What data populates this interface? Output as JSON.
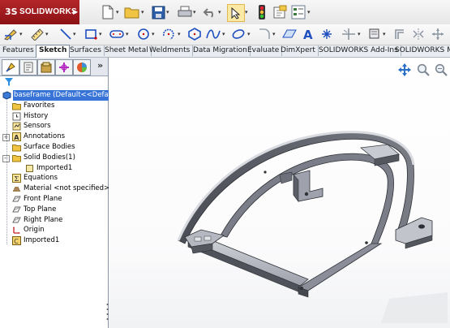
{
  "app": {
    "brand": "SOLIDWORKS",
    "brand_mark": "3S"
  },
  "standard_toolbar": {
    "icons": [
      "new-document-icon",
      "open-folder-icon",
      "save-icon",
      "print-icon",
      "undo-icon",
      "select-arrow-icon",
      "rebuild-traffic-light-icon",
      "file-properties-icon",
      "options-icon"
    ]
  },
  "sketch_toolbar": {
    "icons": [
      "sketch-icon",
      "smart-dimension-icon",
      "line-icon",
      "rectangle-icon",
      "slot-icon",
      "circle-icon",
      "arc-icon",
      "polygon-icon",
      "spline-icon",
      "ellipse-icon",
      "fillet-icon",
      "plane-icon",
      "text-icon",
      "point-icon",
      "trim-icon",
      "convert-entities-icon",
      "offset-icon",
      "mirror-icon",
      "move-icon"
    ]
  },
  "tabs": [
    {
      "label": "Features",
      "active": false
    },
    {
      "label": "Sketch",
      "active": true
    },
    {
      "label": "Surfaces",
      "active": false
    },
    {
      "label": "Sheet Metal",
      "active": false
    },
    {
      "label": "Weldments",
      "active": false
    },
    {
      "label": "Data Migration",
      "active": false
    },
    {
      "label": "Evaluate",
      "active": false
    },
    {
      "label": "DimXpert",
      "active": false
    },
    {
      "label": "SOLIDWORKS Add-Ins",
      "active": false
    },
    {
      "label": "SOLIDWORKS MBD",
      "active": false
    }
  ],
  "feature_manager": {
    "panel_tabs": [
      "feature-manager-tree-icon",
      "property-manager-icon",
      "configuration-manager-icon",
      "dimxpert-manager-icon",
      "display-manager-icon"
    ],
    "expand_glyph": "»",
    "tree": {
      "root": "baseframe  (Default<<Default>",
      "items": [
        {
          "label": "Favorites",
          "icon": "favorites-folder-icon"
        },
        {
          "label": "History",
          "icon": "history-icon"
        },
        {
          "label": "Sensors",
          "icon": "sensors-icon"
        },
        {
          "label": "Annotations",
          "icon": "annotations-icon",
          "expander": "+"
        },
        {
          "label": "Surface Bodies",
          "icon": "surface-bodies-folder-icon"
        },
        {
          "label": "Solid Bodies(1)",
          "icon": "solid-bodies-folder-icon",
          "expander": "−"
        },
        {
          "label": "Imported1",
          "icon": "solid-body-icon",
          "child": true
        },
        {
          "label": "Equations",
          "icon": "equations-icon"
        },
        {
          "label": "Material <not specified>",
          "icon": "material-icon"
        },
        {
          "label": "Front Plane",
          "icon": "plane-icon"
        },
        {
          "label": "Top Plane",
          "icon": "plane-icon"
        },
        {
          "label": "Right Plane",
          "icon": "plane-icon"
        },
        {
          "label": "Origin",
          "icon": "origin-icon"
        },
        {
          "label": "Imported1",
          "icon": "imported-feature-icon"
        }
      ]
    }
  },
  "viewport": {
    "hud_icons": [
      "zoom-to-fit-icon",
      "zoom-to-area-icon",
      "previous-view-icon"
    ],
    "model": "baseframe part"
  }
}
